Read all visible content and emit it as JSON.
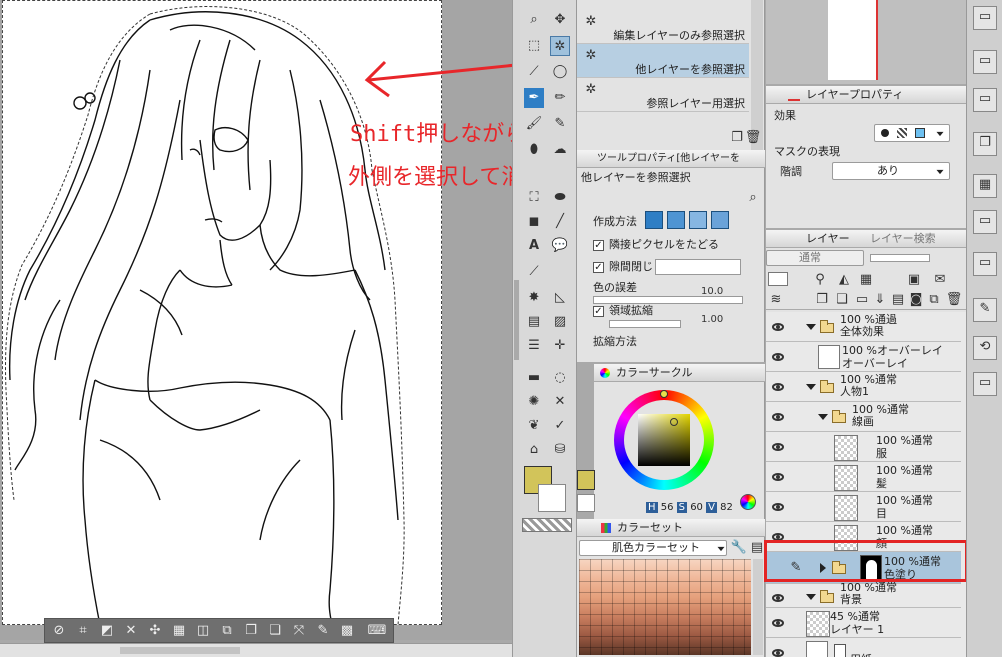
{
  "annotation": {
    "line1": "Shift押しながら",
    "line2": "外側を選択して消去",
    "color": "#e8262a"
  },
  "selection_panel": {
    "items": [
      "編集レイヤーのみ参照選択",
      "他レイヤーを参照選択",
      "参照レイヤー用選択"
    ]
  },
  "tool_property": {
    "title": "ツールプロパティ[他レイヤーを",
    "subtitle": "他レイヤーを参照選択",
    "method_label": "作成方法",
    "adjacent_label": "隣接ピクセルをたどる",
    "gap_label": "隙間閉じ",
    "tolerance_label": "色の誤差",
    "tolerance_value": "10.0",
    "expand_label": "領域拡縮",
    "expand_value": "1.00",
    "expand_method_label": "拡縮方法"
  },
  "color_circle": {
    "title": "カラーサークル",
    "h_label": "H",
    "h": "56",
    "s_label": "S",
    "s": "60",
    "v_label": "V",
    "v": "82",
    "main_color": "#d2c45a"
  },
  "color_set": {
    "title": "カラーセット",
    "selected": "肌色カラーセット"
  },
  "layer_property": {
    "title": "レイヤープロパティ",
    "effect_label": "効果",
    "mask_label": "マスクの表現",
    "tone_label": "階調",
    "tone_value": "あり"
  },
  "layers_panel": {
    "tab_layer": "レイヤー",
    "tab_search": "レイヤー検索",
    "blend_mode": "通常",
    "layers": [
      {
        "line1": "100 %通過",
        "line2": "全体効果",
        "kind": "folder"
      },
      {
        "line1": "100 %オーバーレイ",
        "line2": "オーバーレイ",
        "kind": "layer"
      },
      {
        "line1": "100 %通常",
        "line2": "人物1",
        "kind": "folder"
      },
      {
        "line1": "100 %通常",
        "line2": "線画",
        "kind": "folder"
      },
      {
        "line1": "100 %通常",
        "line2": "服",
        "kind": "layer"
      },
      {
        "line1": "100 %通常",
        "line2": "髪",
        "kind": "layer"
      },
      {
        "line1": "100 %通常",
        "line2": "目",
        "kind": "layer"
      },
      {
        "line1": "100 %通常",
        "line2": "顔",
        "kind": "layer"
      },
      {
        "line1": "100 %通常",
        "line2": "色塗り",
        "kind": "folder-selected"
      },
      {
        "line1": "100 %通常",
        "line2": "背景",
        "kind": "folder"
      },
      {
        "line1": "45 %通常",
        "line2": "レイヤー 1",
        "kind": "layer"
      },
      {
        "line1": "",
        "line2": "用紙",
        "kind": "paper"
      }
    ]
  },
  "highlight_color": "#e32424"
}
